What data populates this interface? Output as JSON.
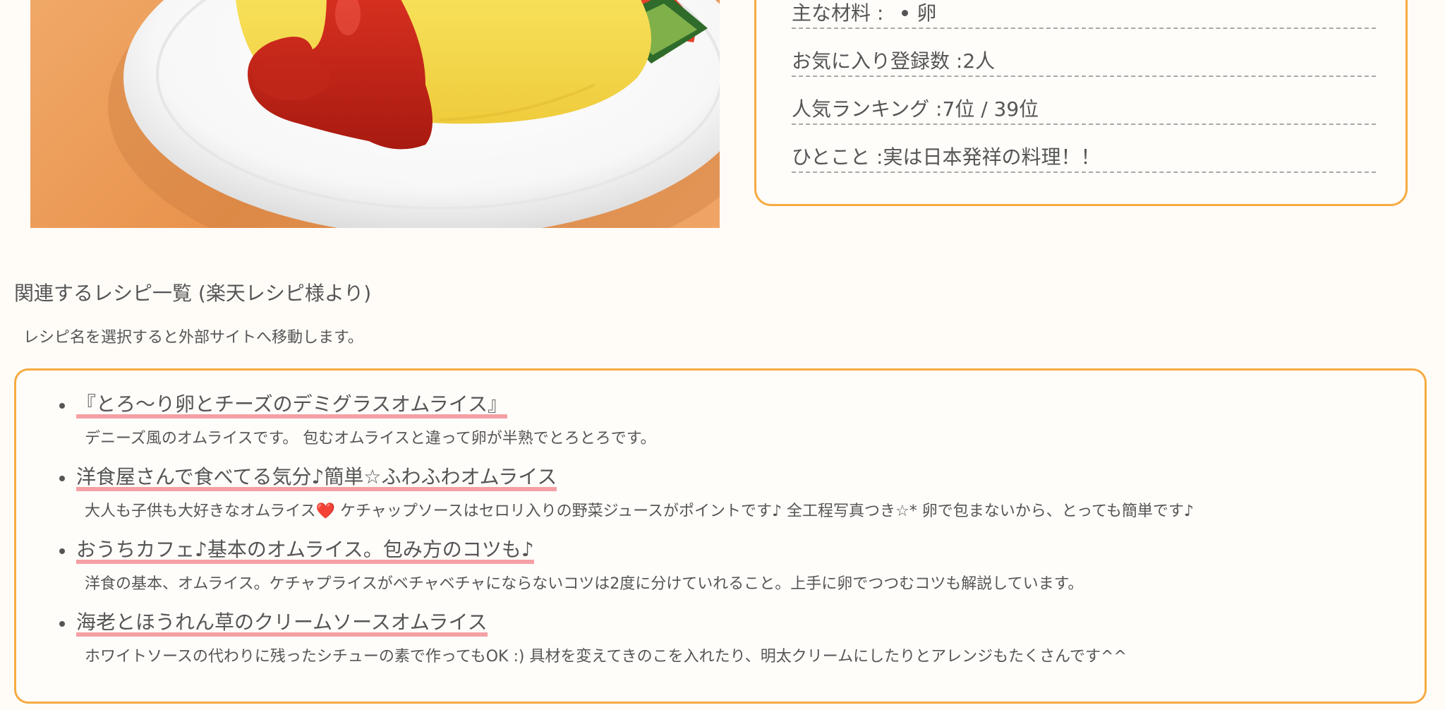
{
  "info": {
    "ingredients_label": "主な材料 :",
    "ingredients_value": "卵",
    "favorites_label": "お気に入り登録数 :",
    "favorites_value": "2人",
    "ranking_label": "人気ランキング :",
    "ranking_value": "7位 / 39位",
    "comment_label": "ひとこと :",
    "comment_value": "実は日本発祥の料理！！"
  },
  "related": {
    "title": "関連するレシピ一覧 (楽天レシピ様より)",
    "note": "レシピ名を選択すると外部サイトへ移動します。",
    "recipes": [
      {
        "title": "『とろ〜り卵とチーズのデミグラスオムライス』",
        "description": "デニーズ風のオムライスです。 包むオムライスと違って卵が半熟でとろとろです。"
      },
      {
        "title": "洋食屋さんで食べてる気分♪簡単☆ふわふわオムライス",
        "description": "大人も子供も大好きなオムライス❤️ ケチャップソースはセロリ入りの野菜ジュースがポイントです♪ 全工程写真つき☆* 卵で包まないから、とっても簡単です♪"
      },
      {
        "title": "おうちカフェ♪基本のオムライス。包み方のコツも♪",
        "description": "洋食の基本、オムライス。ケチャプライスがベチャベチャにならないコツは2度に分けていれること。上手に卵でつつむコツも解説しています。"
      },
      {
        "title": "海老とほうれん草のクリームソースオムライス",
        "description": "ホワイトソースの代わりに残ったシチューの素で作ってもOK :) 具材を変えてきのこを入れたり、明太クリームにしたりとアレンジもたくさんです^^"
      }
    ]
  }
}
